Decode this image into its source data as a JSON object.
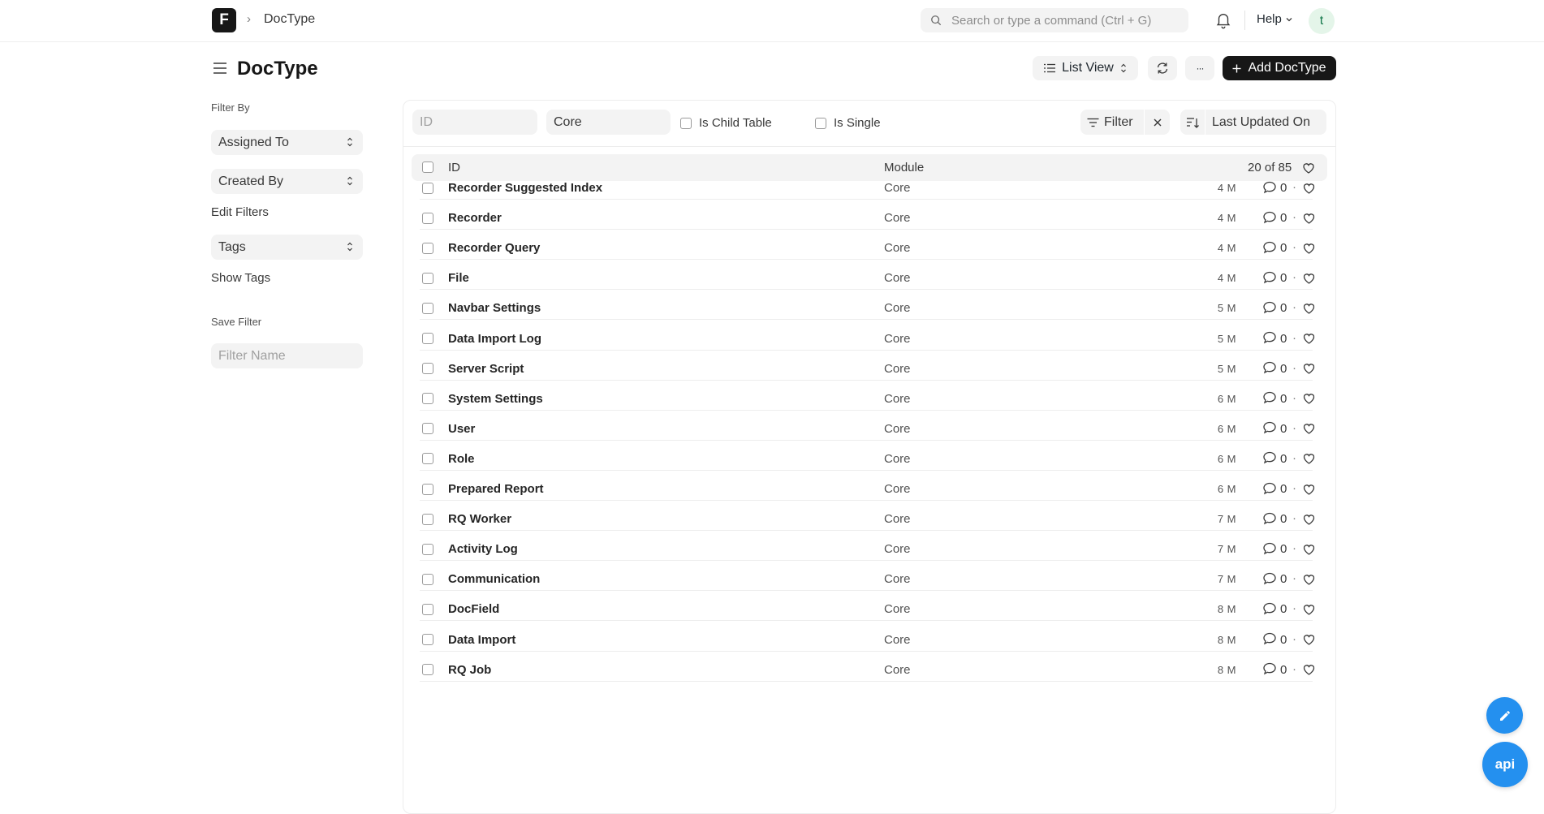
{
  "navbar": {
    "logo_letter": "F",
    "breadcrumb": "DocType",
    "search_placeholder": "Search or type a command (Ctrl + G)",
    "help_label": "Help",
    "avatar_initial": "t"
  },
  "page": {
    "title": "DocType",
    "list_view_label": "List View",
    "more_label": "···",
    "add_label": "Add DocType"
  },
  "sidebar": {
    "filter_by": "Filter By",
    "assigned_to": "Assigned To",
    "created_by": "Created By",
    "edit_filters": "Edit Filters",
    "tags": "Tags",
    "show_tags": "Show Tags",
    "save_filter": "Save Filter",
    "filter_name_placeholder": "Filter Name"
  },
  "filters": {
    "id_placeholder": "ID",
    "module_value": "Core",
    "is_child_table": "Is Child Table",
    "is_single": "Is Single",
    "filter_label": "Filter",
    "sort_label": "Last Updated On"
  },
  "table": {
    "col_id": "ID",
    "col_module": "Module",
    "count": "20 of 85",
    "rows": [
      {
        "name": "Recorder Suggested Index",
        "module": "Core",
        "time": "4 M",
        "comments": "0"
      },
      {
        "name": "Recorder",
        "module": "Core",
        "time": "4 M",
        "comments": "0"
      },
      {
        "name": "Recorder Query",
        "module": "Core",
        "time": "4 M",
        "comments": "0"
      },
      {
        "name": "File",
        "module": "Core",
        "time": "4 M",
        "comments": "0"
      },
      {
        "name": "Navbar Settings",
        "module": "Core",
        "time": "5 M",
        "comments": "0"
      },
      {
        "name": "Data Import Log",
        "module": "Core",
        "time": "5 M",
        "comments": "0"
      },
      {
        "name": "Server Script",
        "module": "Core",
        "time": "5 M",
        "comments": "0"
      },
      {
        "name": "System Settings",
        "module": "Core",
        "time": "6 M",
        "comments": "0"
      },
      {
        "name": "User",
        "module": "Core",
        "time": "6 M",
        "comments": "0"
      },
      {
        "name": "Role",
        "module": "Core",
        "time": "6 M",
        "comments": "0"
      },
      {
        "name": "Prepared Report",
        "module": "Core",
        "time": "6 M",
        "comments": "0"
      },
      {
        "name": "RQ Worker",
        "module": "Core",
        "time": "7 M",
        "comments": "0"
      },
      {
        "name": "Activity Log",
        "module": "Core",
        "time": "7 M",
        "comments": "0"
      },
      {
        "name": "Communication",
        "module": "Core",
        "time": "7 M",
        "comments": "0"
      },
      {
        "name": "DocField",
        "module": "Core",
        "time": "8 M",
        "comments": "0"
      },
      {
        "name": "Data Import",
        "module": "Core",
        "time": "8 M",
        "comments": "0"
      },
      {
        "name": "RQ Job",
        "module": "Core",
        "time": "8 M",
        "comments": "0"
      }
    ]
  },
  "fab": {
    "api_label": "api",
    "edit_icon": "pencil-icon"
  },
  "colors": {
    "primary": "#171717",
    "accent": "#2490ef"
  }
}
